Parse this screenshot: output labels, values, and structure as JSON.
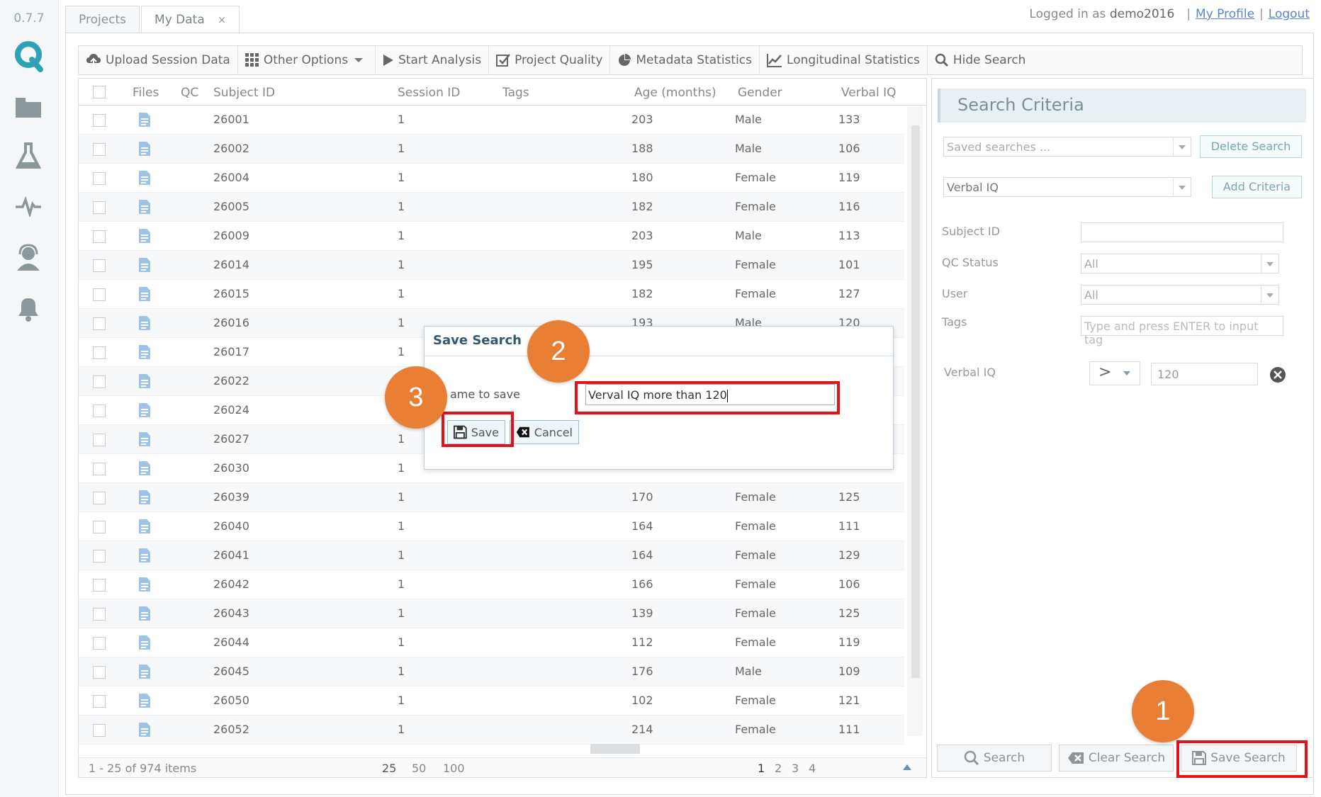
{
  "app": {
    "version": "0.7.7",
    "tabs": [
      {
        "label": "Projects"
      },
      {
        "label": "My Data",
        "close": "×"
      }
    ],
    "login": {
      "prefix": "Logged in as",
      "user": "demo2016",
      "profile": "My Profile",
      "logout": "Logout",
      "sep": "|"
    }
  },
  "toolbar": {
    "upload": "Upload Session Data",
    "other": "Other Options",
    "start": "Start Analysis",
    "quality": "Project Quality",
    "metadata": "Metadata Statistics",
    "longitudinal": "Longitudinal Statistics",
    "hide": "Hide Search"
  },
  "grid": {
    "columns": [
      "Files",
      "QC",
      "Subject ID",
      "Session ID",
      "Tags",
      "Age (months)",
      "Gender",
      "Verbal IQ"
    ],
    "rows": [
      {
        "subject": "26001",
        "session": "1",
        "age": "203",
        "gender": "Male",
        "viq": "133"
      },
      {
        "subject": "26002",
        "session": "1",
        "age": "188",
        "gender": "Male",
        "viq": "106"
      },
      {
        "subject": "26004",
        "session": "1",
        "age": "180",
        "gender": "Female",
        "viq": "119"
      },
      {
        "subject": "26005",
        "session": "1",
        "age": "182",
        "gender": "Female",
        "viq": "116"
      },
      {
        "subject": "26009",
        "session": "1",
        "age": "203",
        "gender": "Male",
        "viq": "113"
      },
      {
        "subject": "26014",
        "session": "1",
        "age": "195",
        "gender": "Female",
        "viq": "101"
      },
      {
        "subject": "26015",
        "session": "1",
        "age": "182",
        "gender": "Female",
        "viq": "127"
      },
      {
        "subject": "26016",
        "session": "1",
        "age": "193",
        "gender": "Male",
        "viq": "120"
      },
      {
        "subject": "26017",
        "session": "1",
        "age": "",
        "gender": "",
        "viq": ""
      },
      {
        "subject": "26022",
        "session": "1",
        "age": "",
        "gender": "",
        "viq": ""
      },
      {
        "subject": "26024",
        "session": "1",
        "age": "",
        "gender": "",
        "viq": ""
      },
      {
        "subject": "26027",
        "session": "1",
        "age": "",
        "gender": "",
        "viq": ""
      },
      {
        "subject": "26030",
        "session": "1",
        "age": "",
        "gender": "",
        "viq": ""
      },
      {
        "subject": "26039",
        "session": "1",
        "age": "170",
        "gender": "Female",
        "viq": "125"
      },
      {
        "subject": "26040",
        "session": "1",
        "age": "164",
        "gender": "Female",
        "viq": "111"
      },
      {
        "subject": "26041",
        "session": "1",
        "age": "164",
        "gender": "Female",
        "viq": "129"
      },
      {
        "subject": "26042",
        "session": "1",
        "age": "166",
        "gender": "Female",
        "viq": "106"
      },
      {
        "subject": "26043",
        "session": "1",
        "age": "139",
        "gender": "Female",
        "viq": "125"
      },
      {
        "subject": "26044",
        "session": "1",
        "age": "112",
        "gender": "Female",
        "viq": "119"
      },
      {
        "subject": "26045",
        "session": "1",
        "age": "176",
        "gender": "Male",
        "viq": "109"
      },
      {
        "subject": "26050",
        "session": "1",
        "age": "102",
        "gender": "Female",
        "viq": "121"
      },
      {
        "subject": "26052",
        "session": "1",
        "age": "214",
        "gender": "Female",
        "viq": "111"
      }
    ],
    "footer": {
      "summary": "1 - 25 of 974 items",
      "page_sizes": [
        "25",
        "50",
        "100"
      ],
      "pages": [
        "1",
        "2",
        "3",
        "4"
      ]
    }
  },
  "criteria": {
    "title": "Search Criteria",
    "saved_placeholder": "Saved searches ...",
    "delete": "Delete Search",
    "criteria_select": "Verbal IQ",
    "add": "Add Criteria",
    "subject_label": "Subject ID",
    "qc_label": "QC Status",
    "qc_value": "All",
    "user_label": "User",
    "user_value": "All",
    "tags_label": "Tags",
    "tags_placeholder": "Type and press ENTER to input tag",
    "viq_label": "Verbal IQ",
    "viq_op": ">",
    "viq_value": "120",
    "search": "Search",
    "clear": "Clear Search",
    "save": "Save Search"
  },
  "modal": {
    "title": "Save Search",
    "label": "ame to save",
    "value": "Verval IQ more than 120",
    "save": "Save",
    "cancel": "Cancel"
  },
  "callouts": [
    "1",
    "2",
    "3"
  ],
  "colors": {
    "accent": "#2fa3b6",
    "callout": "#e97f35",
    "highlight": "#e0121a"
  }
}
